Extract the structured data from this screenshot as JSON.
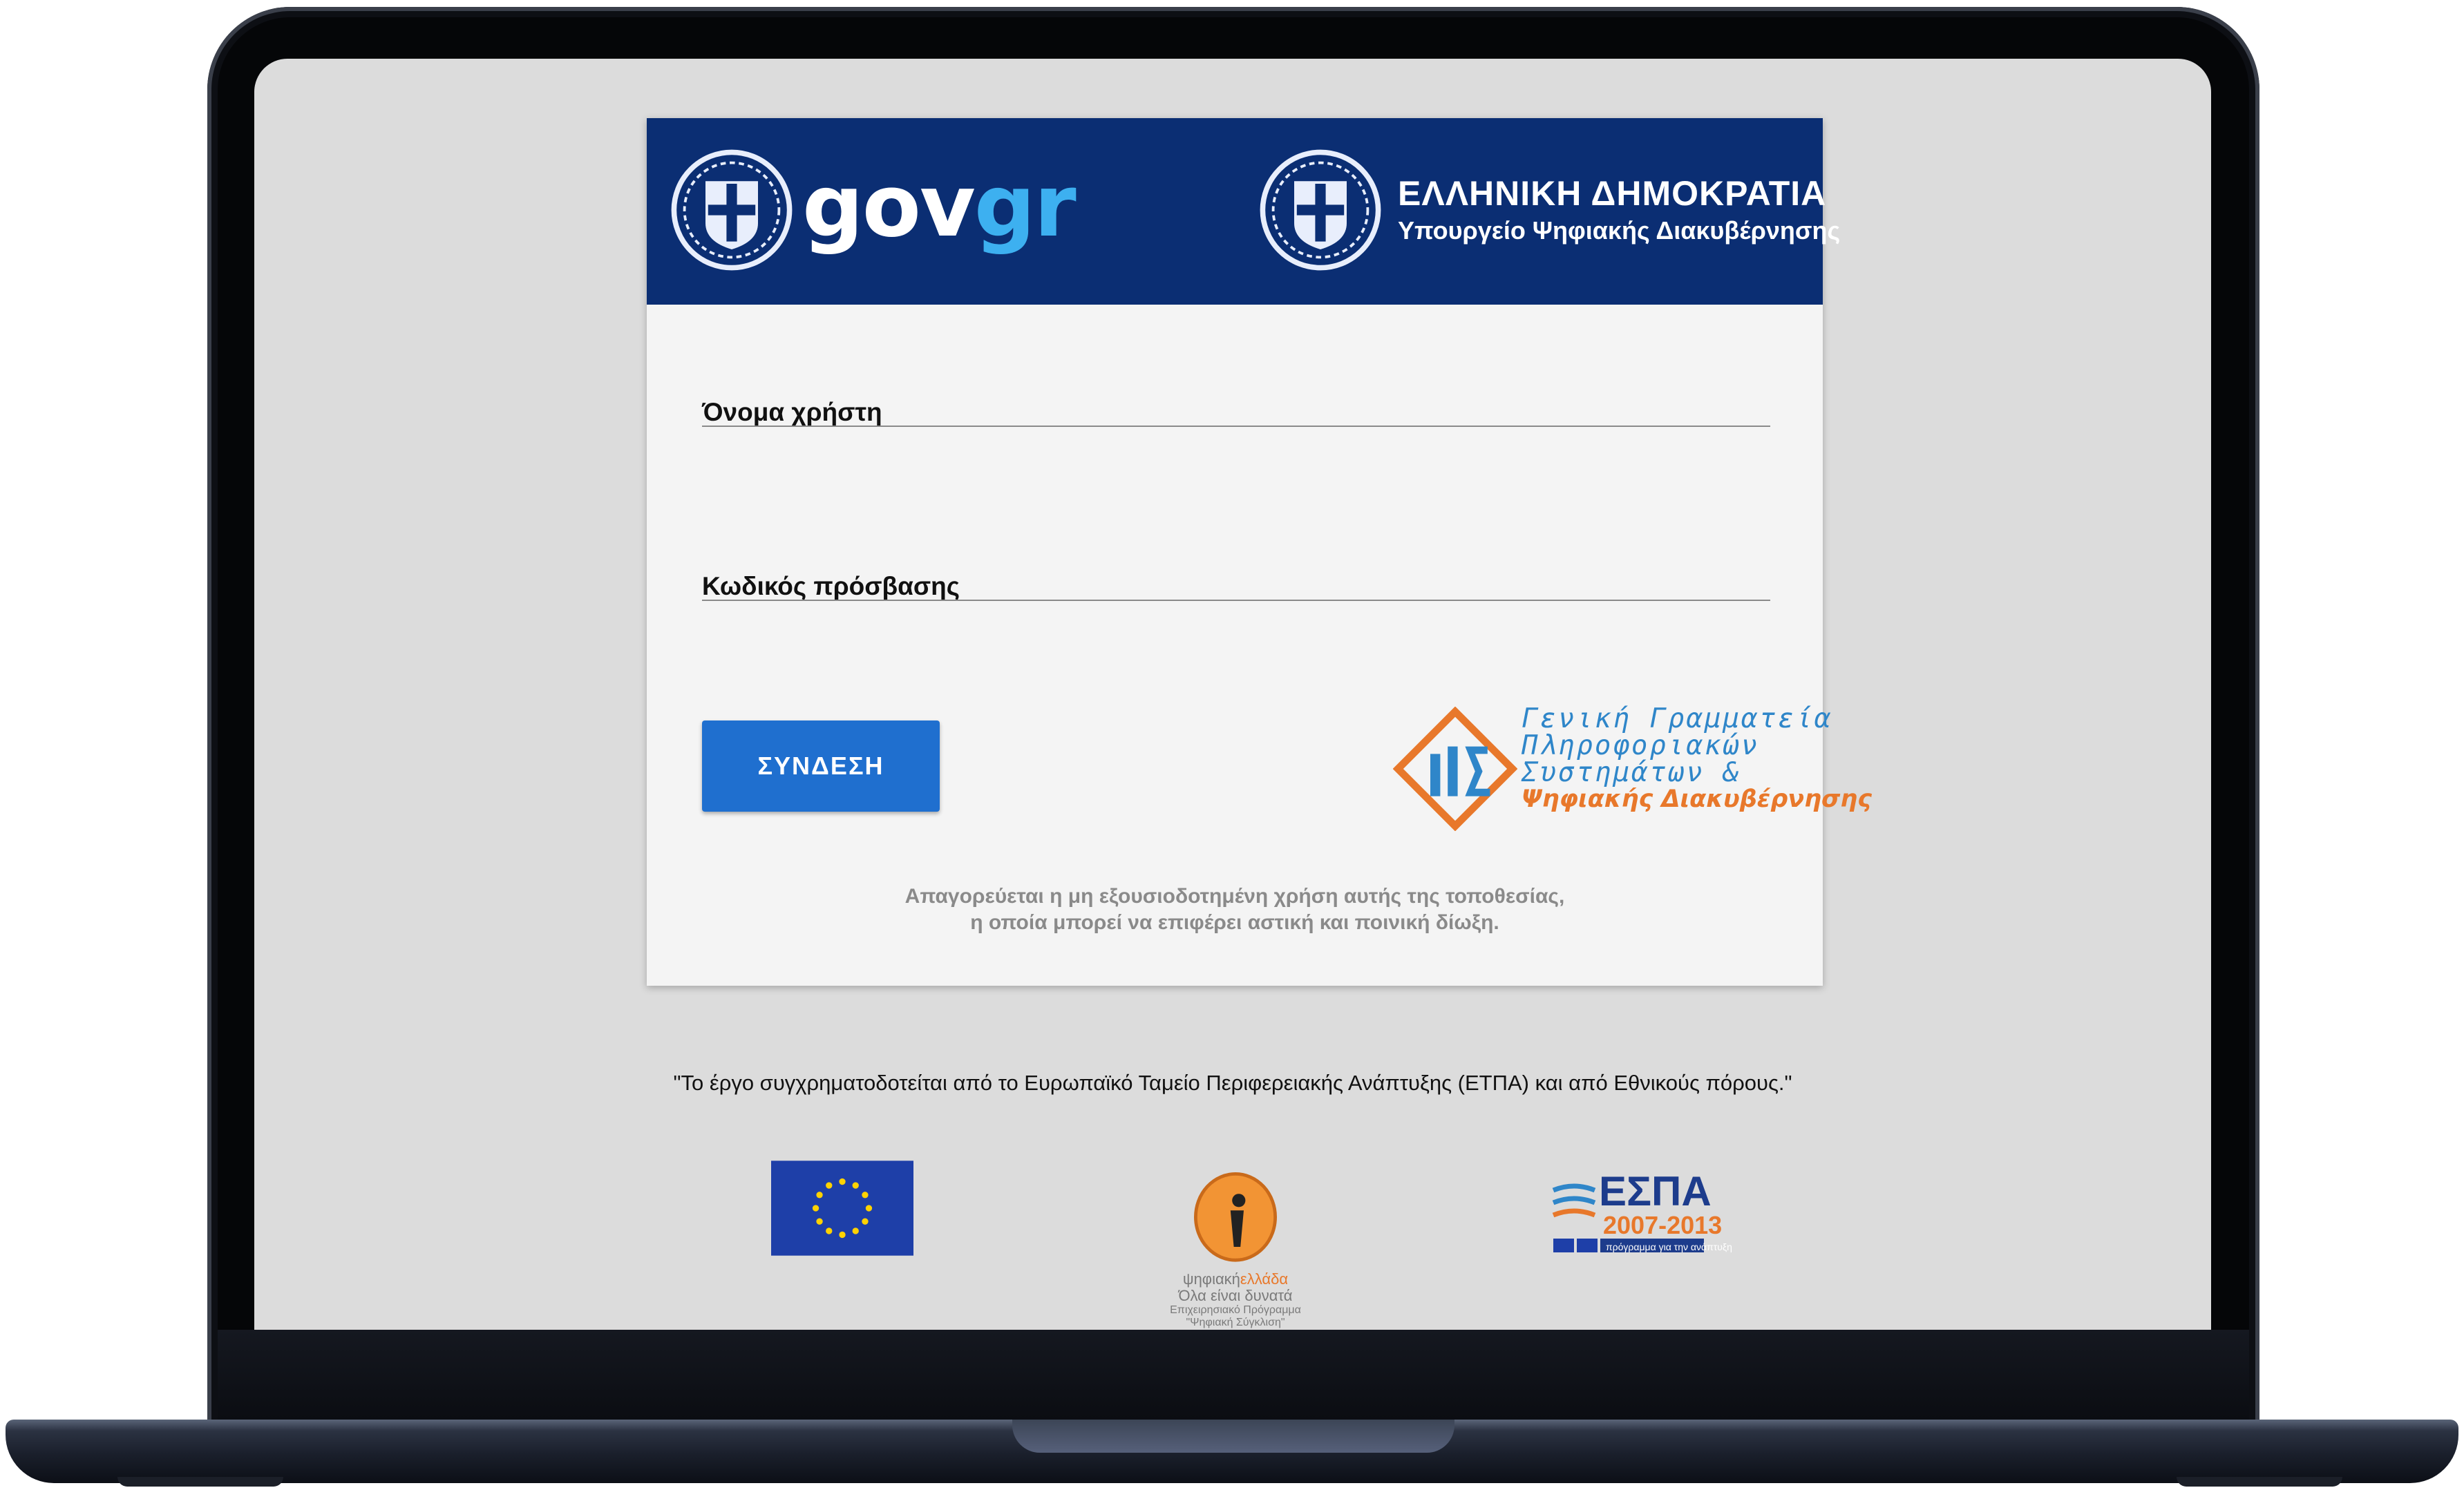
{
  "header": {
    "brand_part1": "gov",
    "brand_part2": "gr",
    "republic": "ΕΛΛΗΝΙΚΗ ΔΗΜΟΚΡΑΤΙΑ",
    "ministry": "Υπουργείο Ψηφιακής Διακυβέρνησης"
  },
  "form": {
    "username_label": "Όνομα χρήστη",
    "username_value": "",
    "password_label": "Κωδικός πρόσβασης",
    "password_value": "",
    "login_button": "ΣΥΝΔΕΣΗ"
  },
  "gsis": {
    "line1": "Γενική Γραμματεία",
    "line2": "Πληροφοριακών",
    "line3": "Συστημάτων &",
    "line4": "Ψηφιακής Διακυβέρνησης"
  },
  "warning": {
    "line1": "Απαγορεύεται η μη εξουσιοδοτημένη χρήση αυτής της τοποθεσίας,",
    "line2": "η οποία μπορεί να επιφέρει αστική και ποινική δίωξη."
  },
  "footer": {
    "funding_note": "\"Το έργο συγχρηματοδοτείται από το Ευρωπαϊκό Ταμείο Περιφερειακής Ανάπτυξης (ΕΤΠΑ) και από Εθνικούς πόρους.\"",
    "digital_greece_part1": "ψηφιακή",
    "digital_greece_part2": "ελλάδα",
    "digital_greece_slogan": "Όλα είναι δυνατά",
    "digital_greece_program": "Επιχειρησιακό Πρόγραμμα",
    "digital_greece_program2": "\"Ψηφιακή Σύγκλιση\"",
    "espa_title": "ΕΣΠΑ",
    "espa_years": "2007-2013",
    "espa_slogan": "πρόγραμμα για την ανάπτυξη"
  },
  "colors": {
    "header_bg": "#0b2e73",
    "button_bg": "#1f6fcf",
    "gov_accent": "#3db0f0",
    "gsis_blue": "#2f86c9",
    "gsis_orange": "#e8782b"
  },
  "icons": {
    "emblem": "greek-state-emblem",
    "eu": "eu-flag",
    "digital": "digital-greece-logo",
    "espa": "espa-logo",
    "gsis": "gsis-logo"
  }
}
